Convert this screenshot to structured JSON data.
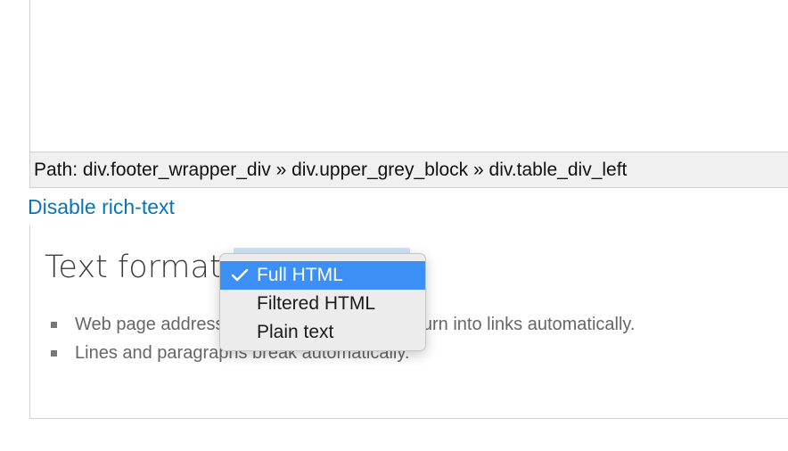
{
  "path_bar": {
    "text": "Path: div.footer_wrapper_div » div.upper_grey_block » div.table_div_left"
  },
  "disable_link": {
    "label": "Disable rich-text"
  },
  "text_format": {
    "title": "Text format",
    "tips": [
      "Web page addresses and email addresses turn into links automatically.",
      "Lines and paragraphs break automatically."
    ]
  },
  "format_dropdown": {
    "selected": "Full HTML",
    "options": [
      "Full HTML",
      "Filtered HTML",
      "Plain text"
    ]
  },
  "colors": {
    "link": "#0d73b5",
    "selection": "#3b8ff5"
  }
}
